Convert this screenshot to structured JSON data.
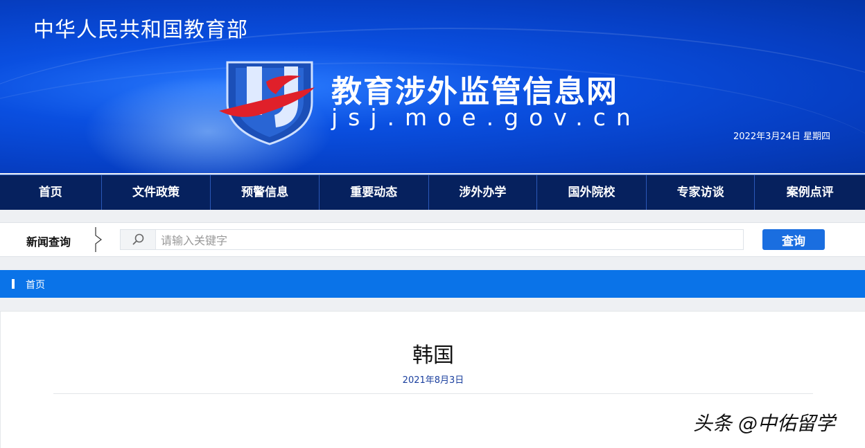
{
  "header": {
    "ministry_name": "中华人民共和国教育部",
    "site_title": "教育涉外监管信息网",
    "site_url": "jsj.moe.gov.cn",
    "date": "2022年3月24日 星期四"
  },
  "nav": {
    "items": [
      {
        "label": "首页"
      },
      {
        "label": "文件政策"
      },
      {
        "label": "预警信息"
      },
      {
        "label": "重要动态"
      },
      {
        "label": "涉外办学"
      },
      {
        "label": "国外院校"
      },
      {
        "label": "专家访谈"
      },
      {
        "label": "案例点评"
      }
    ]
  },
  "search": {
    "label": "新闻查询",
    "placeholder": "请输入关键字",
    "value": "",
    "button_label": "查询"
  },
  "breadcrumb": {
    "home": "首页"
  },
  "article": {
    "title": "韩国",
    "date": "2021年8月3日"
  },
  "watermark": "头条 @中佑留学",
  "colors": {
    "nav_bg": "#06215e",
    "accent_blue": "#0a73e8",
    "button_blue": "#1a6ee0",
    "logo_red": "#e0202a"
  }
}
